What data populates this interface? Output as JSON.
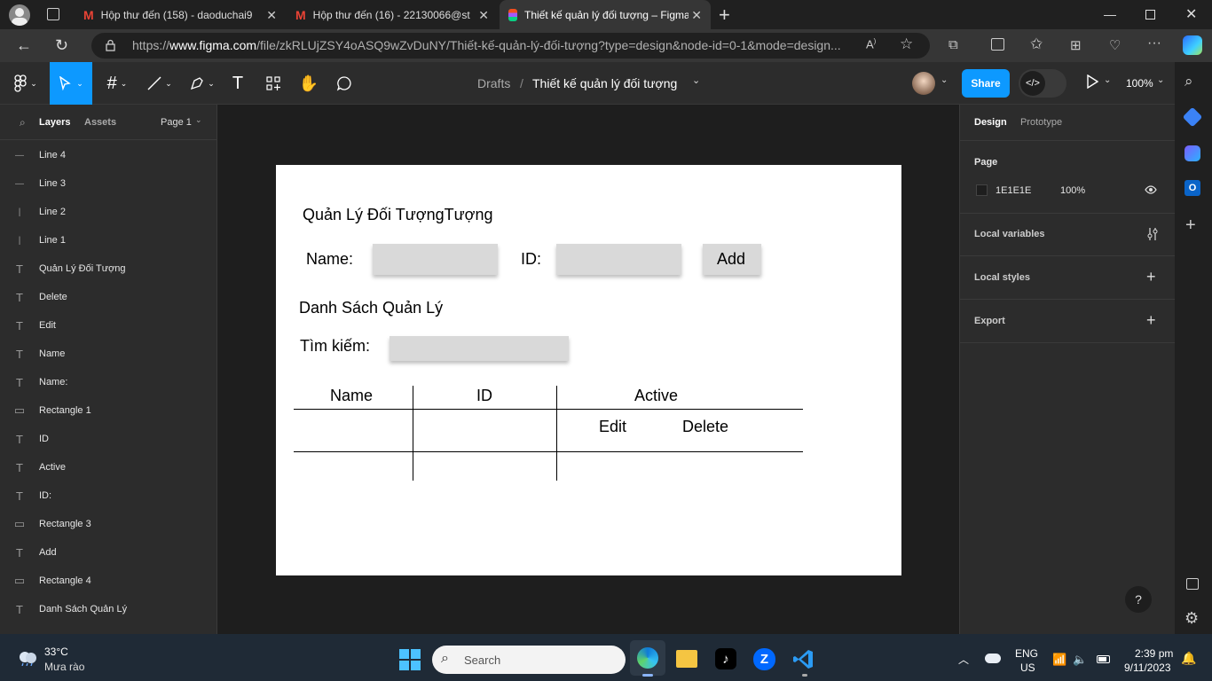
{
  "browser": {
    "tabs": [
      {
        "title": "Hộp thư đến (158) - daoduchai9",
        "icon": "gmail-icon"
      },
      {
        "title": "Hộp thư đến (16) - 22130066@st",
        "icon": "gmail-icon"
      },
      {
        "title": "Thiết kế quản lý đối tượng – Figma",
        "icon": "figma-icon",
        "active": true
      }
    ],
    "new_tab": "+",
    "url_prefix": "https://",
    "url_host": "www.figma.com",
    "url_path": "/file/zkRLUjZSY4oASQ9wZvDuNY/Thiết-kế-quản-lý-đối-tượng?type=design&node-id=0-1&mode=design..."
  },
  "figma": {
    "breadcrumb_root": "Drafts",
    "breadcrumb_sep": "/",
    "file_name": "Thiết kế quản lý đối tượng",
    "share_label": "Share",
    "zoom": "100%",
    "panel_tabs": {
      "layers": "Layers",
      "assets": "Assets",
      "page": "Page 1"
    },
    "layers": [
      {
        "name": "Line 4",
        "type": "line"
      },
      {
        "name": "Line 3",
        "type": "line"
      },
      {
        "name": "Line 2",
        "type": "vline"
      },
      {
        "name": "Line 1",
        "type": "vline"
      },
      {
        "name": "Quản Lý Đối Tượng",
        "type": "text"
      },
      {
        "name": "Delete",
        "type": "text"
      },
      {
        "name": "Edit",
        "type": "text"
      },
      {
        "name": "Name",
        "type": "text"
      },
      {
        "name": "Name:",
        "type": "text"
      },
      {
        "name": "Rectangle 1",
        "type": "rect"
      },
      {
        "name": "ID",
        "type": "text"
      },
      {
        "name": "Active",
        "type": "text"
      },
      {
        "name": "ID:",
        "type": "text"
      },
      {
        "name": "Rectangle 3",
        "type": "rect"
      },
      {
        "name": "Add",
        "type": "text"
      },
      {
        "name": "Rectangle 4",
        "type": "rect"
      },
      {
        "name": "Danh Sách Quản Lý",
        "type": "text"
      }
    ],
    "right_panel": {
      "tab_design": "Design",
      "tab_prototype": "Prototype",
      "page_label": "Page",
      "page_color": "1E1E1E",
      "page_opacity": "100%",
      "local_variables": "Local variables",
      "local_styles": "Local styles",
      "export": "Export"
    },
    "help": "?"
  },
  "design": {
    "title": "Quản Lý Đối TượngTượng",
    "name_label": "Name:",
    "id_label": "ID:",
    "add_label": "Add",
    "list_title": "Danh Sách Quản Lý",
    "search_label": "Tìm kiếm:",
    "col_name": "Name",
    "col_id": "ID",
    "col_active": "Active",
    "edit": "Edit",
    "delete": "Delete"
  },
  "taskbar": {
    "temp": "33°C",
    "weather": "Mưa rào",
    "search_placeholder": "Search",
    "lang": "ENG",
    "region": "US",
    "time": "2:39 pm",
    "date": "9/11/2023"
  },
  "colors": {
    "figma_blue": "#0d99ff",
    "canvas_bg": "#1e1e1e",
    "input_gray": "#d9d9d9"
  }
}
